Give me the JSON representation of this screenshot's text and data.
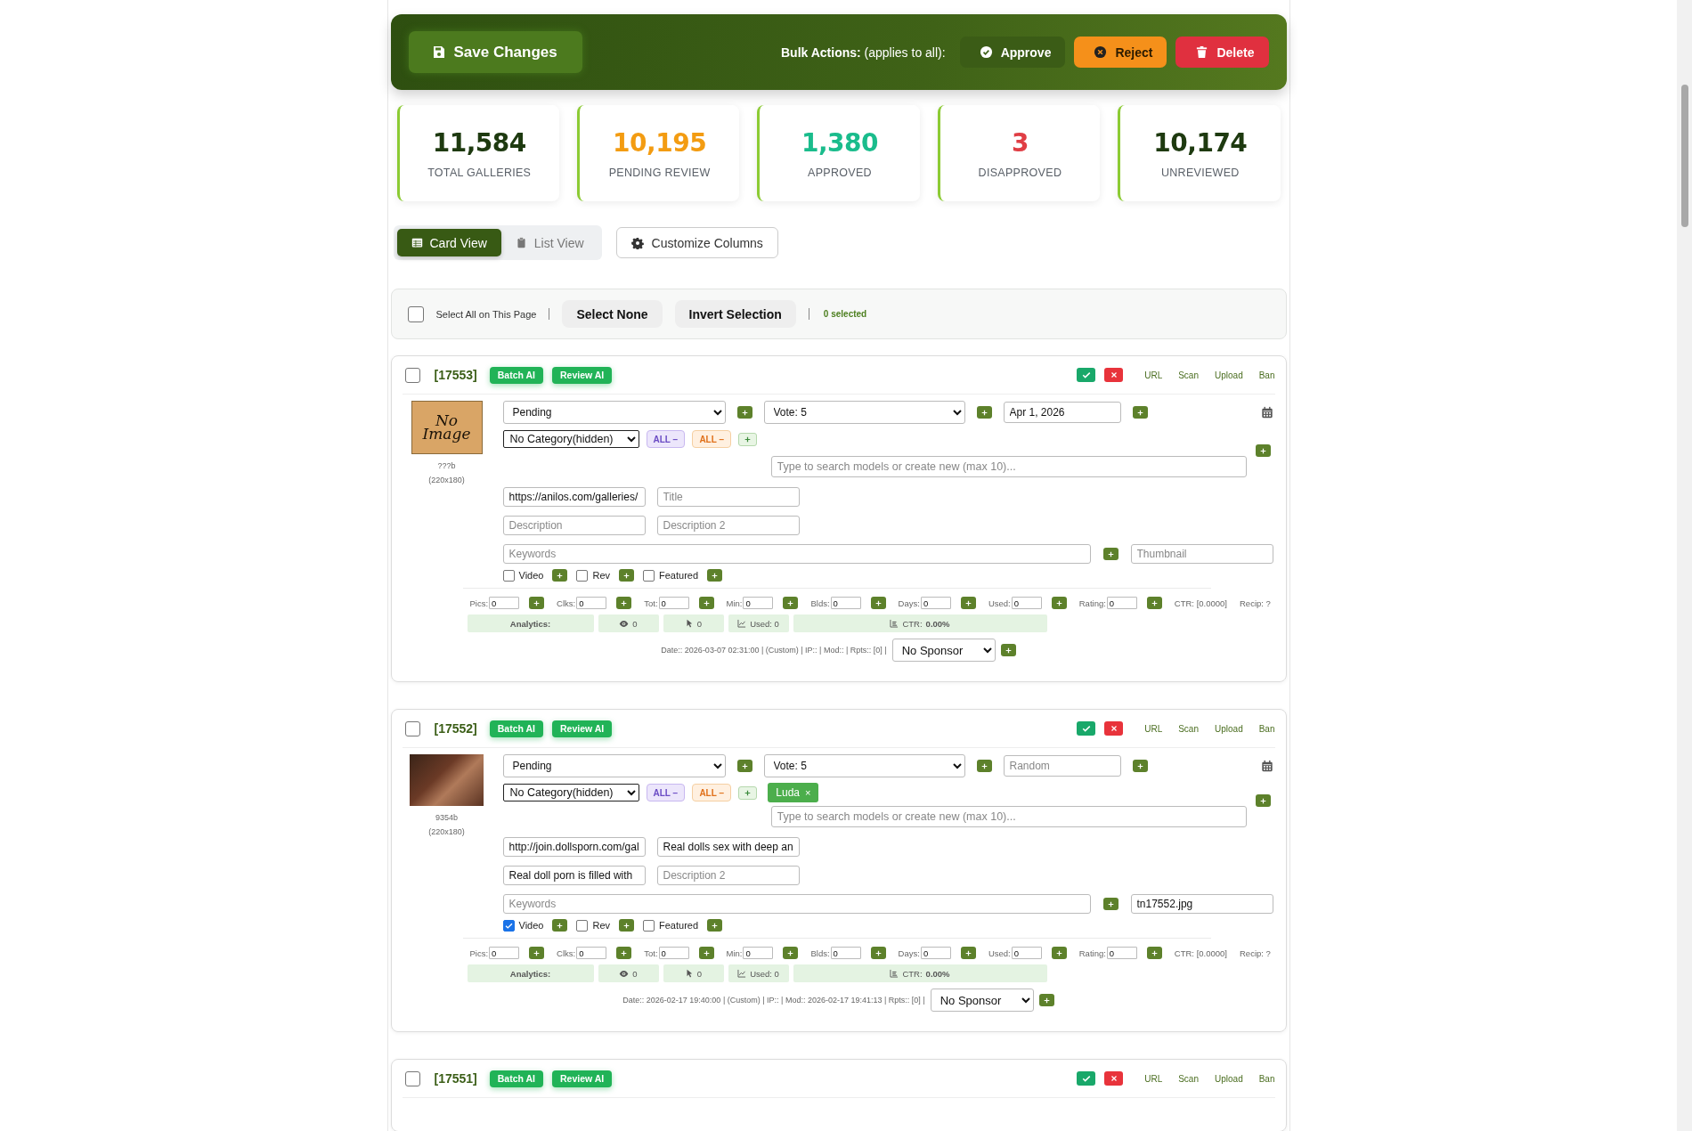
{
  "toolbar": {
    "save_button": "Save Changes",
    "bulk_label": "Bulk Actions:",
    "bulk_hint": "(applies to all):",
    "actions": [
      {
        "kind": "approve",
        "label": "Approve"
      },
      {
        "kind": "reject",
        "label": "Reject"
      },
      {
        "kind": "delete",
        "label": "Delete"
      }
    ]
  },
  "stats": [
    {
      "value": "11,584",
      "label": "TOTAL GALLERIES",
      "color": "#1e3a10"
    },
    {
      "value": "10,195",
      "label": "PENDING REVIEW",
      "color": "#f39c12"
    },
    {
      "value": "1,380",
      "label": "APPROVED",
      "color": "#1abc8c"
    },
    {
      "value": "3",
      "label": "DISAPPROVED",
      "color": "#e03e45"
    },
    {
      "value": "10,174",
      "label": "UNREVIEWED",
      "color": "#1e3a10"
    }
  ],
  "view_tabs": [
    {
      "kind": "card",
      "label": "Card View",
      "selected": true
    },
    {
      "kind": "list",
      "label": "List View",
      "selected": false
    }
  ],
  "customize_button": "Customize Columns",
  "selection_bar": {
    "select_all_label": "Select All on This Page",
    "select_all_checked": false,
    "select_none": "Select None",
    "invert": "Invert Selection",
    "count": "0 selected"
  },
  "galleries": [
    {
      "id": "[17553]",
      "checked": false,
      "batch_ai": "Batch AI",
      "review_ai": "Review AI",
      "links": [
        "URL",
        "Scan",
        "Upload",
        "Ban"
      ],
      "thumbnail": {
        "kind": "no-image",
        "label": "No Image",
        "caption": "???b",
        "size": "(220x180)"
      },
      "status": "Pending",
      "vote": "Vote: 5",
      "date": {
        "value": "Apr 1, 2026"
      },
      "category": "No Category(hidden)",
      "all_tags": [
        {
          "kind": "purple",
          "label": "ALL −"
        },
        {
          "kind": "orange",
          "label": "ALL −"
        }
      ],
      "model_search": {
        "placeholder": "Type to search models or create new (max 10)..."
      },
      "url": {
        "value": "https://anilos.com/galleries/"
      },
      "title": {
        "placeholder": "Title"
      },
      "description": {
        "placeholder": "Description"
      },
      "description_2": {
        "placeholder": "Description 2"
      },
      "keywords": {
        "placeholder": "Keywords"
      },
      "thumbnail_field": {
        "placeholder": "Thumbnail"
      },
      "flags": [
        {
          "label": "Video",
          "checked": false
        },
        {
          "label": "Rev",
          "checked": false
        },
        {
          "label": "Featured",
          "checked": false
        }
      ],
      "metrics": [
        {
          "label": "Pics:",
          "value": "0"
        },
        {
          "label": "Clks:",
          "value": "0"
        },
        {
          "label": "Tot:",
          "value": "0"
        },
        {
          "label": "Min:",
          "value": "0"
        },
        {
          "label": "Blds:",
          "value": "0"
        },
        {
          "label": "Days:",
          "value": "0"
        },
        {
          "label": "Used:",
          "value": "0"
        },
        {
          "label": "Rating:",
          "value": "0"
        }
      ],
      "ctr": "CTR: [0.0000]",
      "recip": "Recip: ?",
      "analytics": {
        "label": "Analytics:",
        "views": "0",
        "clicks": "0",
        "used": "Used: 0",
        "ctr_label": "CTR:",
        "ctr_value": "0.00%"
      },
      "meta": "Date:: 2026-03-07 02:31:00 | (Custom) | IP:: | Mod:: | Rpts:: [0] |",
      "sponsor": "No Sponsor"
    },
    {
      "id": "[17552]",
      "checked": false,
      "batch_ai": "Batch AI",
      "review_ai": "Review AI",
      "links": [
        "URL",
        "Scan",
        "Upload",
        "Ban"
      ],
      "thumbnail": {
        "kind": "photo",
        "caption": "9354b",
        "size": "(220x180)"
      },
      "status": "Pending",
      "vote": "Vote: 5",
      "date": {
        "placeholder": "Random"
      },
      "category": "No Category(hidden)",
      "all_tags": [
        {
          "kind": "purple",
          "label": "ALL −"
        },
        {
          "kind": "orange",
          "label": "ALL −"
        }
      ],
      "models": [
        {
          "label": "Luda",
          "remove": "×"
        }
      ],
      "model_search": {
        "placeholder": "Type to search models or create new (max 10)..."
      },
      "url": {
        "value": "http://join.dollsporn.com/gal"
      },
      "title": {
        "value": "Real dolls sex with deep an"
      },
      "description": {
        "value": "Real doll porn is filled with"
      },
      "description_2": {
        "placeholder": "Description 2"
      },
      "keywords": {
        "placeholder": "Keywords"
      },
      "thumbnail_field": {
        "value": "tn17552.jpg"
      },
      "flags": [
        {
          "label": "Video",
          "checked": true
        },
        {
          "label": "Rev",
          "checked": false
        },
        {
          "label": "Featured",
          "checked": false
        }
      ],
      "metrics": [
        {
          "label": "Pics:",
          "value": "0"
        },
        {
          "label": "Clks:",
          "value": "0"
        },
        {
          "label": "Tot:",
          "value": "0"
        },
        {
          "label": "Min:",
          "value": "0"
        },
        {
          "label": "Blds:",
          "value": "0"
        },
        {
          "label": "Days:",
          "value": "0"
        },
        {
          "label": "Used:",
          "value": "0"
        },
        {
          "label": "Rating:",
          "value": "0"
        }
      ],
      "ctr": "CTR: [0.0000]",
      "recip": "Recip: ?",
      "analytics": {
        "label": "Analytics:",
        "views": "0",
        "clicks": "0",
        "used": "Used: 0",
        "ctr_label": "CTR:",
        "ctr_value": "0.00%"
      },
      "meta": "Date:: 2026-02-17 19:40:00 | (Custom) | IP:: | Mod:: 2026-02-17 19:41:13 | Rpts:: [0] |",
      "sponsor": "No Sponsor"
    },
    {
      "id": "[17551]",
      "checked": false,
      "batch_ai": "Batch AI",
      "review_ai": "Review AI",
      "links": [
        "URL",
        "Scan",
        "Upload",
        "Ban"
      ]
    }
  ]
}
